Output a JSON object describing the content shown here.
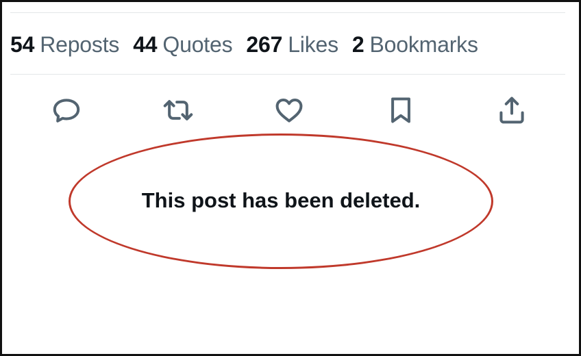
{
  "stats": {
    "reposts": {
      "count": "54",
      "label": "Reposts"
    },
    "quotes": {
      "count": "44",
      "label": "Quotes"
    },
    "likes": {
      "count": "267",
      "label": "Likes"
    },
    "bookmarks": {
      "count": "2",
      "label": "Bookmarks"
    }
  },
  "actions": [
    {
      "icon": "reply-icon"
    },
    {
      "icon": "repost-icon"
    },
    {
      "icon": "heart-icon"
    },
    {
      "icon": "bookmark-icon"
    },
    {
      "icon": "share-icon"
    }
  ],
  "annotation": {
    "message": "This post has been deleted.",
    "circle_color": "#c0392b"
  },
  "colors": {
    "primary_text": "#0f1419",
    "secondary_text": "#536471",
    "divider": "#e3e6e8"
  }
}
